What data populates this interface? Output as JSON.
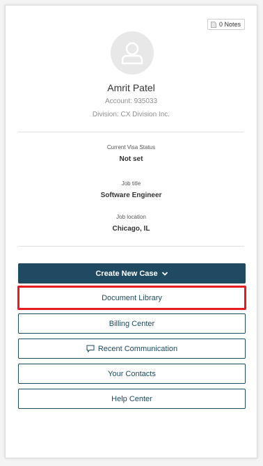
{
  "notes_button": {
    "label": "0 Notes",
    "icon": "document-icon"
  },
  "profile": {
    "name": "Amrit Patel",
    "account": "Account: 935033",
    "division": "Division: CX Division Inc."
  },
  "fields": [
    {
      "label": "Current Visa Status",
      "value": "Not set"
    },
    {
      "label": "Job title",
      "value": "Software Engineer"
    },
    {
      "label": "Job location",
      "value": "Chicago, IL"
    }
  ],
  "actions": {
    "create_case": "Create New Case",
    "document_library": "Document Library",
    "billing_center": "Billing Center",
    "recent_communication": "Recent Communication",
    "your_contacts": "Your Contacts",
    "help_center": "Help Center"
  },
  "colors": {
    "primary": "#1f4a62",
    "highlight": "#e41b23"
  }
}
